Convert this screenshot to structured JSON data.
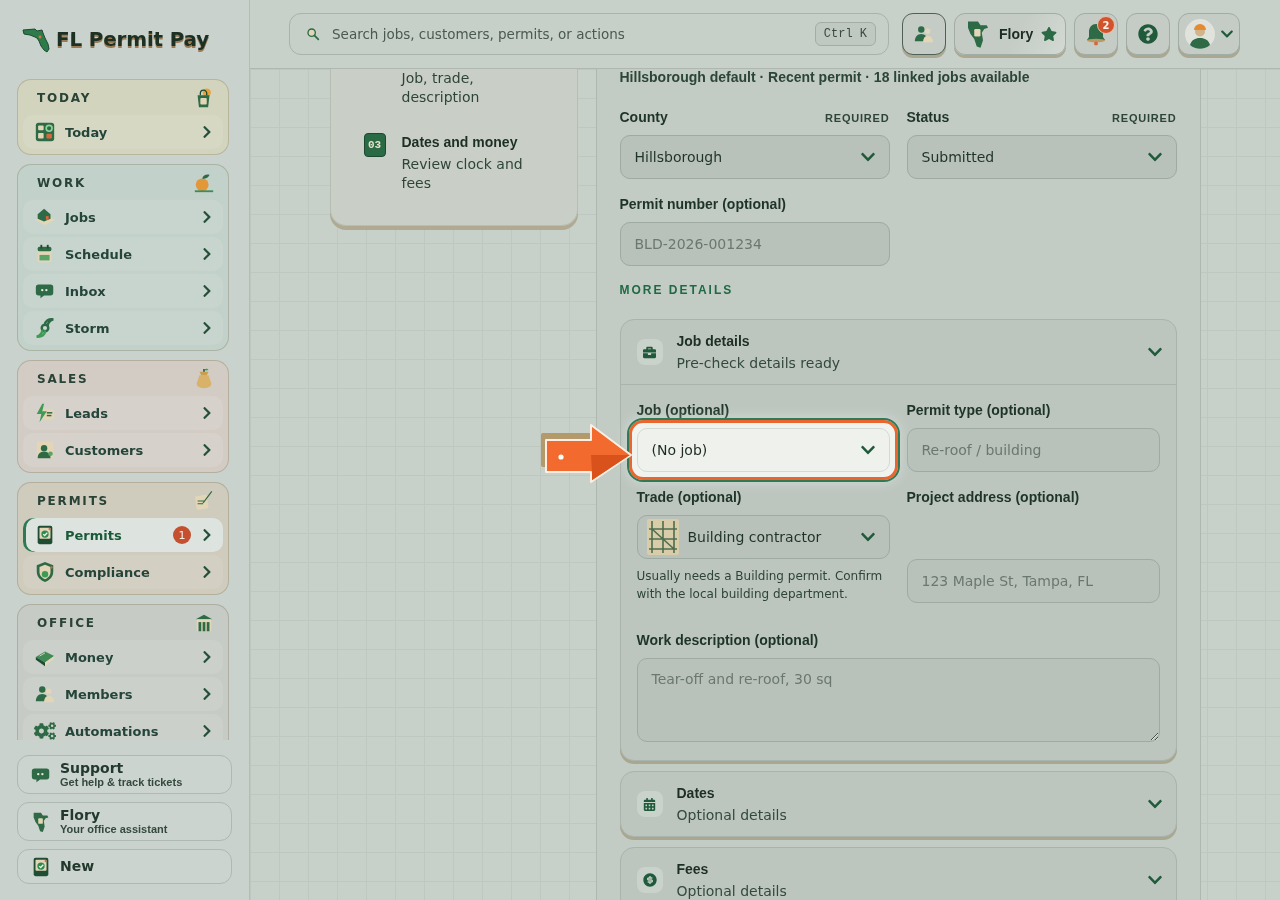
{
  "app": {
    "name": "FL Permit Pay"
  },
  "sidebar": {
    "groups": [
      {
        "title": "TODAY",
        "color": "#d3d4be",
        "items": [
          {
            "label": "Today",
            "selected": false
          }
        ]
      },
      {
        "title": "WORK",
        "color": "#c2d1c9",
        "items": [
          {
            "label": "Jobs",
            "selected": false
          },
          {
            "label": "Schedule",
            "selected": false
          },
          {
            "label": "Inbox",
            "selected": false
          },
          {
            "label": "Storm",
            "selected": false
          }
        ]
      },
      {
        "title": "SALES",
        "color": "#d2ccc4",
        "items": [
          {
            "label": "Leads",
            "selected": false
          },
          {
            "label": "Customers",
            "selected": false
          }
        ]
      },
      {
        "title": "PERMITS",
        "color": "#cfcbbd",
        "items": [
          {
            "label": "Permits",
            "selected": true,
            "badge": "1"
          },
          {
            "label": "Compliance",
            "selected": false
          }
        ]
      },
      {
        "title": "OFFICE",
        "color": "#c6cbc5",
        "items": [
          {
            "label": "Money",
            "selected": false
          },
          {
            "label": "Members",
            "selected": false
          },
          {
            "label": "Automations",
            "selected": false
          }
        ]
      }
    ],
    "footer": [
      {
        "title": "Support",
        "subtitle": "Get help & track tickets"
      },
      {
        "title": "Flory",
        "subtitle": "Your office assistant"
      },
      {
        "title": "New"
      }
    ]
  },
  "topbar": {
    "search": {
      "placeholder": "Search jobs, customers, permits, or actions",
      "shortcut": "Ctrl K"
    },
    "assistant": {
      "name": "Flory"
    },
    "notifications": {
      "count": "2"
    }
  },
  "steps": [
    {
      "description": "Job, trade, description"
    },
    {
      "number": "03",
      "title": "Dates and money",
      "description": "Review clock and fees"
    }
  ],
  "form": {
    "summary": "Hillsborough default · Recent permit · 18 linked jobs available",
    "fields": [
      {
        "kind": "select",
        "label": "County",
        "tag": "REQUIRED",
        "value": "Hillsborough"
      },
      {
        "kind": "select",
        "label": "Status",
        "tag": "REQUIRED",
        "value": "Submitted"
      },
      {
        "kind": "text",
        "label": "Permit number (optional)",
        "placeholder": "BLD-2026-001234"
      }
    ],
    "more_heading": "MORE DETAILS",
    "sections": [
      {
        "title": "Job details",
        "subtitle": "Pre-check details ready",
        "expanded": true,
        "fields": [
          {
            "kind": "select",
            "label": "Job (optional)",
            "value": "(No job)",
            "highlighted": true
          },
          {
            "kind": "text",
            "label": "Permit type (optional)",
            "placeholder": "Re-roof / building",
            "highlighted": false
          },
          {
            "kind": "picker",
            "label": "Trade (optional)",
            "value": "Building contractor",
            "hint": "Usually needs a Building permit. Confirm with the local building department.",
            "highlighted": false
          },
          {
            "kind": "text",
            "label": "Project address (optional)",
            "placeholder": "123 Maple St, Tampa, FL",
            "highlighted": false
          },
          {
            "kind": "textarea",
            "label": "Work description (optional)",
            "placeholder": "Tear-off and re-roof, 30 sq",
            "highlighted": false
          }
        ]
      },
      {
        "title": "Dates",
        "subtitle": "Optional details",
        "expanded": false
      },
      {
        "title": "Fees",
        "subtitle": "Optional details",
        "expanded": false
      }
    ]
  }
}
